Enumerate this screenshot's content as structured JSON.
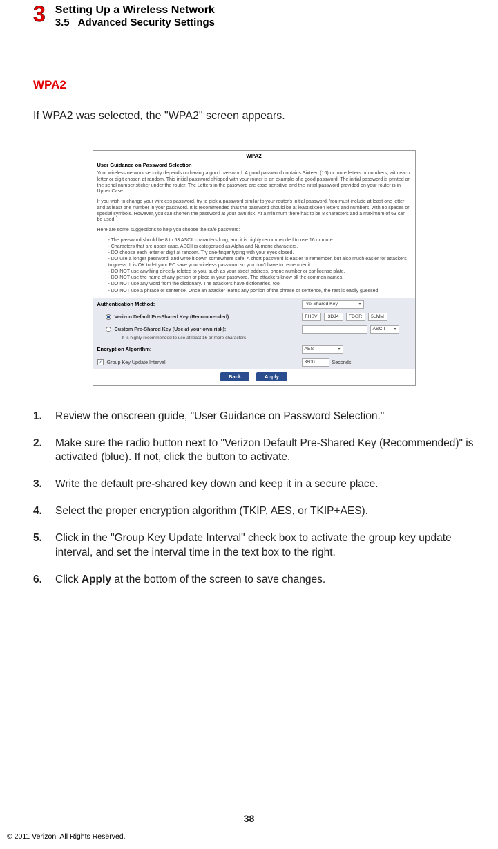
{
  "header": {
    "chapter_number": "3",
    "chapter_title": "Setting Up a Wireless Network",
    "section_number": "3.5",
    "section_title": "Advanced Security Settings"
  },
  "heading": "WPA2",
  "intro": "If WPA2  was selected, the \"WPA2\" screen appears.",
  "screenshot": {
    "title": "WPA2",
    "guidance_heading": "User Guidance on Password Selection",
    "para1": "Your wireless network security depends on having a good password. A good password contains Sixteen (16) or more letters or numbers, with each letter or digit chosen at random. This initial password shipped with your router is an example of a good password. The initial password is printed on the serial number sticker under the router. The Letters in the password are case sensitive and the initial password provided on your router is in Upper Case.",
    "para2": "If you wish to change your wireless password, try to pick a password similar to your router's initial password. You must include at least one letter and at least one number in your password. It is recommended that the password should be at least sixteen letters and numbers, with no spaces or special symbols. However, you can shorten the password at your own risk. At a minimum there has to be 8 characters and a maximum of 63 can be used.",
    "suggestions_intro": "Here are some suggestions to help you choose the safe password:",
    "suggestions": [
      "The password should be 8 to 63 ASCII characters long, and it is highly recommended to use 16 or more.",
      "Characters that are upper case. ASCII is categorized as Alpha and Numeric characters.",
      "DO choose each letter or digit at random. Try one-finger typing with your eyes closed.",
      "DO use a longer password, and write it down somewhere safe. A short password is easier to remember, but also much easier for attackers to guess. It is OK to let your PC save your wireless password so you don't have to remember it.",
      "DO NOT use anything directly related to you, such as your street address, phone number or car license plate.",
      "DO NOT use the name of any person or place in your password. The attackers know all the common names.",
      "DO NOT use any word from the dictionary. The attackers have dictionaries, too.",
      "DO NOT use a phrase or sentence. Once an attacker learns any portion of the phrase or sentence, the rest is easily guessed."
    ],
    "auth_method_label": "Authentication Method:",
    "auth_method_value": "Pre-Shared Key",
    "radio_default_label": "Verizon Default Pre-Shared Key (Recommended):",
    "default_key_segments": [
      "FHSV",
      "3DJ4",
      "FDGR",
      "5LMM"
    ],
    "radio_custom_label": "Custom Pre-Shared Key (Use at your own risk):",
    "custom_key_note": "It is highly recommended to use at least 16 or more characters",
    "custom_type_value": "ASCII",
    "enc_alg_label": "Encryption Algorithm:",
    "enc_alg_value": "AES",
    "group_key_label": "Group Key Update Interval",
    "group_key_value": "3600",
    "group_key_unit": "Seconds",
    "btn_back": "Back",
    "btn_apply": "Apply"
  },
  "steps": [
    {
      "num": "1.",
      "text": "Review the onscreen guide, \"User Guidance on Password Selection.\""
    },
    {
      "num": "2.",
      "text": "Make sure the radio button next to \"Verizon Default Pre-Shared Key (Recommended)\" is activated (blue). If not, click the button to activate."
    },
    {
      "num": "3.",
      "text": "Write the default pre-shared key down and keep it in a secure place."
    },
    {
      "num": "4.",
      "text": "Select the proper encryption algorithm (TKIP, AES, or TKIP+AES)."
    },
    {
      "num": "5.",
      "text": "Click in the \"Group Key Update Interval\" check box to activate the group key update interval, and set the interval time in the text box to the right."
    },
    {
      "num": "6.",
      "text_pre": "Click ",
      "bold": "Apply",
      "text_post": " at the bottom of the screen to save changes."
    }
  ],
  "page_number": "38",
  "copyright": "© 2011 Verizon. All Rights Reserved."
}
